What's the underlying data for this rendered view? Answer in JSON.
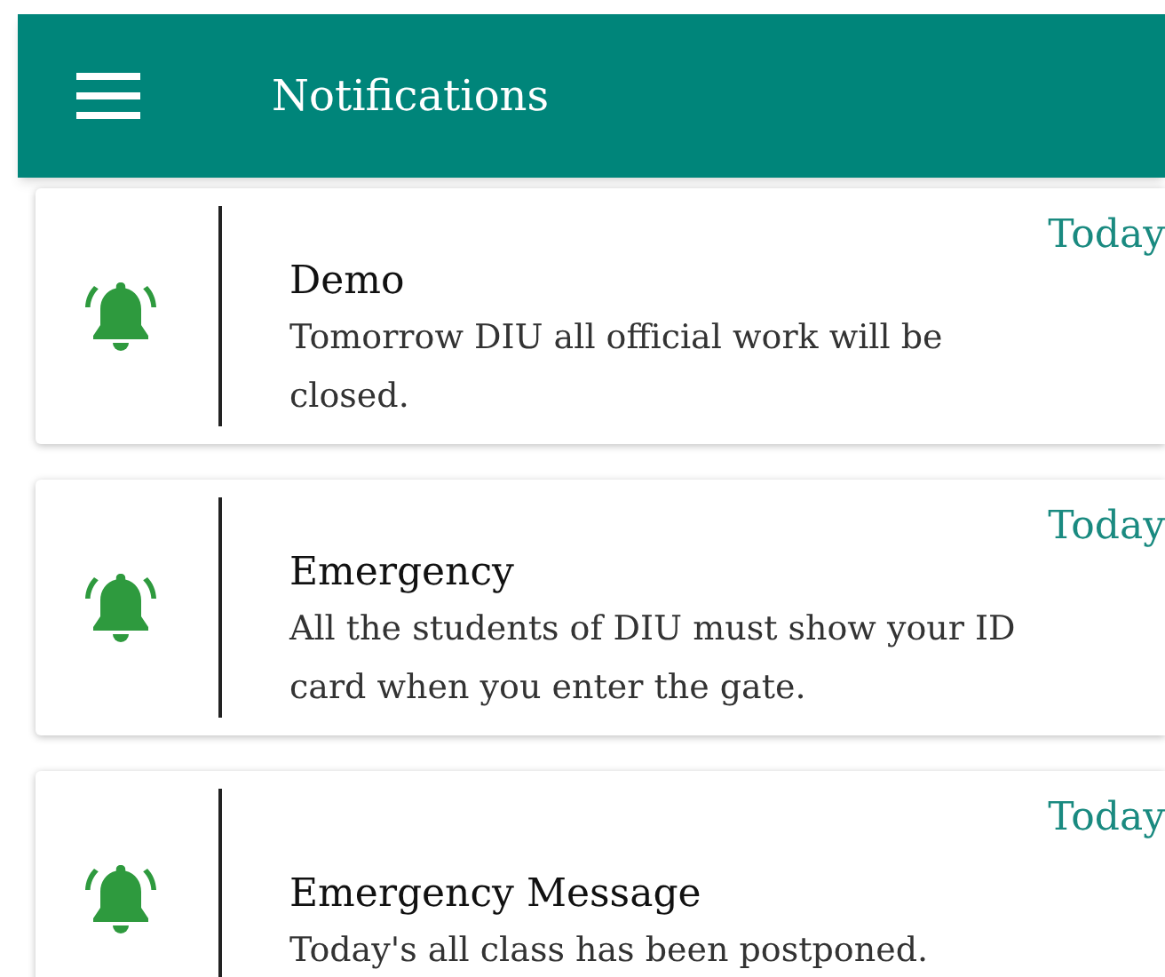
{
  "app_bar": {
    "title": "Notifications"
  },
  "notifications": [
    {
      "date": "Today",
      "title": "Demo",
      "message": "Tomorrow DIU all official work will be closed."
    },
    {
      "date": "Today",
      "title": "Emergency",
      "message": "All the students of DIU must show your ID card when you enter the gate."
    },
    {
      "date": "Today",
      "title": "Emergency Message",
      "message": "Today's all class has been postponed."
    }
  ]
}
